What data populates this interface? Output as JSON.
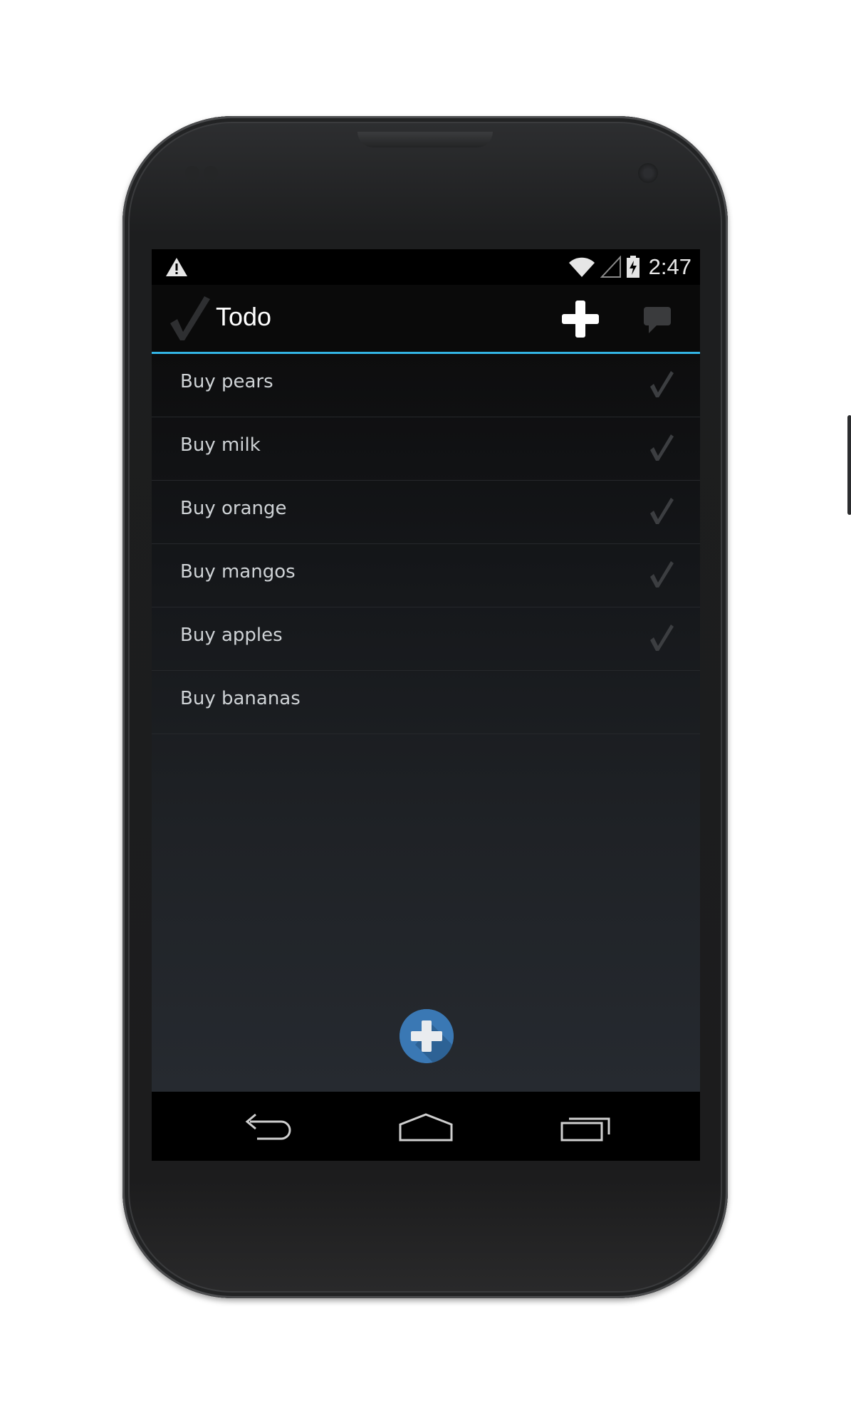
{
  "status_bar": {
    "time": "2:47",
    "icons": [
      "warning-icon",
      "wifi-icon",
      "signal-icon",
      "battery-charging-icon"
    ]
  },
  "action_bar": {
    "title": "Todo",
    "accent_color": "#33b5e5",
    "icons": [
      "checkmark-logo-icon",
      "plus-icon",
      "comment-icon"
    ]
  },
  "todos": [
    {
      "label": "Buy pears",
      "done": true
    },
    {
      "label": "Buy milk",
      "done": true
    },
    {
      "label": "Buy orange",
      "done": true
    },
    {
      "label": "Buy mangos",
      "done": true
    },
    {
      "label": "Buy apples",
      "done": true
    },
    {
      "label": "Buy bananas",
      "done": false
    }
  ],
  "fab": {
    "icon": "plus-icon",
    "color": "#3a78b4"
  },
  "nav_bar": {
    "icons": [
      "back-icon",
      "home-icon",
      "recent-apps-icon"
    ]
  }
}
